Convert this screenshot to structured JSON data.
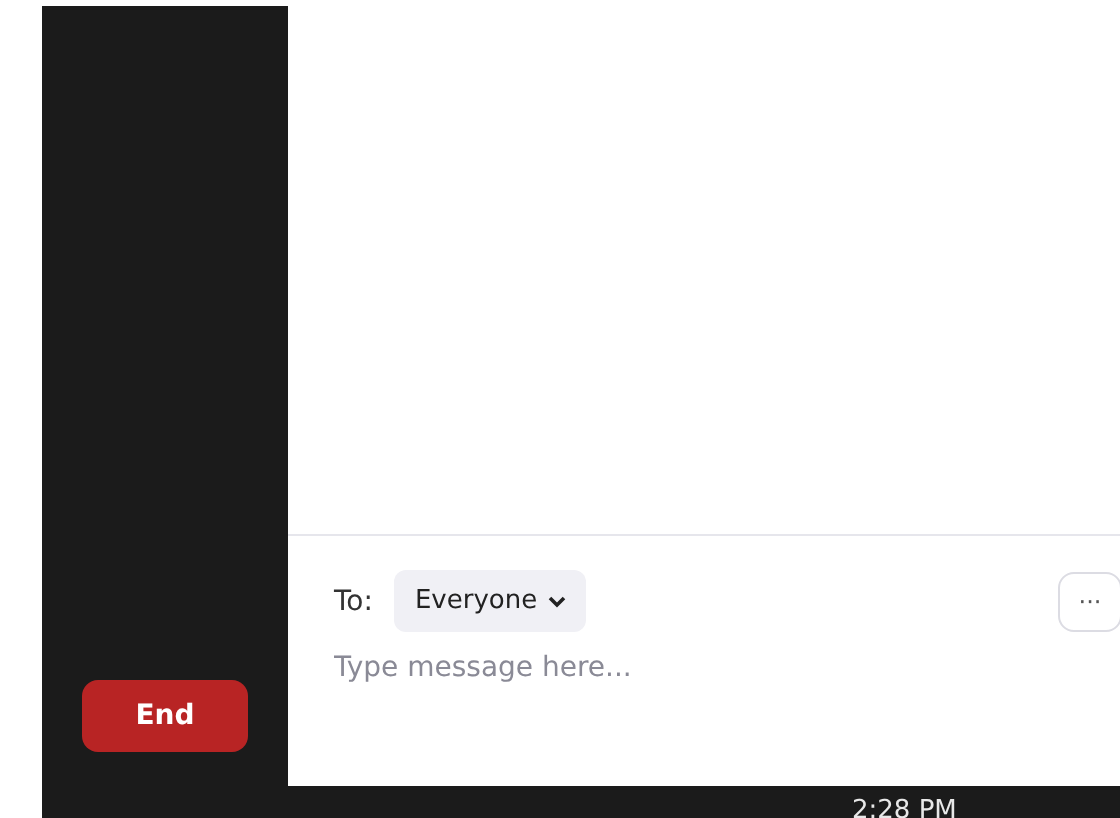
{
  "end_button": {
    "label": "End"
  },
  "chat": {
    "to_label": "To:",
    "recipient": "Everyone",
    "more": "···",
    "message_field": {
      "placeholder": "Type message here..."
    }
  },
  "status_bar": {
    "time": "2:28 PM"
  }
}
